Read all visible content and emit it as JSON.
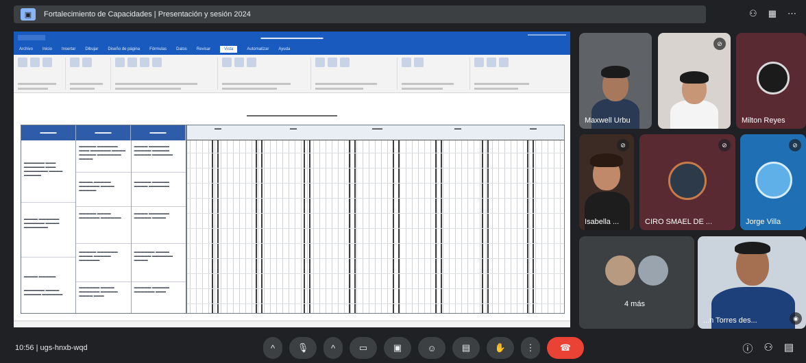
{
  "presentation": {
    "title": "Fortalecimiento de Capacidades | Presentación y sesión 2024"
  },
  "excel": {
    "tabs": [
      "Archivo",
      "Inicio",
      "Insertar",
      "Dibujar",
      "Diseño de página",
      "Fórmulas",
      "Datos",
      "Revisar",
      "Vista",
      "Automatizar",
      "Ayuda"
    ],
    "active_tab_index": 8
  },
  "participants": [
    {
      "name": "Maxwell Urbu",
      "color": "#5f6368"
    },
    {
      "name": "",
      "color": "#d9d3cf"
    },
    {
      "name": "Milton Reyes",
      "color": "#5a2a33"
    },
    {
      "name": "Isabella ...",
      "color": "#3c2b24"
    },
    {
      "name": "CIRO SMAEL DE ...",
      "color": "#5a2a33"
    },
    {
      "name": "Jorge Villa",
      "color": "#1f6fb5"
    },
    {
      "name": "4 más",
      "color": "#3c4043"
    },
    {
      "name": "...n Torres des...",
      "color": "#cbd3dc"
    }
  ],
  "meeting": {
    "time": "10:56",
    "code": "ugs-hnxb-wqd"
  },
  "icons": {
    "top": [
      "people-icon",
      "grid-icon",
      "more-icon"
    ],
    "controls": [
      "chevron-icon",
      "mic-icon",
      "chevron-icon",
      "camera-icon",
      "present-icon",
      "emoji-icon",
      "captions-icon",
      "hand-icon",
      "more-vert-icon",
      "end-call-icon"
    ],
    "right": [
      "info-icon",
      "people-icon",
      "chat-icon"
    ]
  }
}
